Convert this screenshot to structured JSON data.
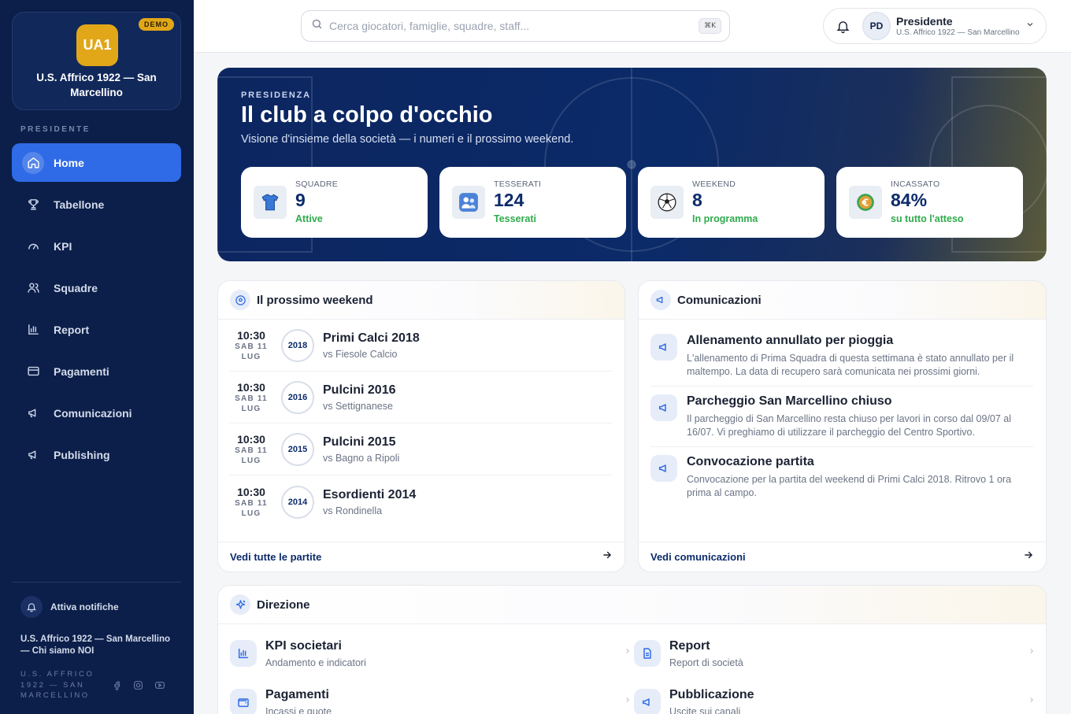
{
  "sidebar": {
    "demo_badge": "DEMO",
    "club_logo": "UA1",
    "club_name": "U.S. Affrico 1922 — San Marcellino",
    "role_label": "PRESIDENTE",
    "items": [
      {
        "label": "Home",
        "icon": "home-icon"
      },
      {
        "label": "Tabellone",
        "icon": "trophy-icon"
      },
      {
        "label": "KPI",
        "icon": "gauge-icon"
      },
      {
        "label": "Squadre",
        "icon": "users-icon"
      },
      {
        "label": "Report",
        "icon": "bar-chart-icon"
      },
      {
        "label": "Pagamenti",
        "icon": "credit-card-icon"
      },
      {
        "label": "Comunicazioni",
        "icon": "megaphone-icon"
      },
      {
        "label": "Publishing",
        "icon": "megaphone-icon"
      }
    ],
    "notifications_label": "Attiva notifiche",
    "footer_club": "U.S. Affrico 1922 — San Marcellino — Chi siamo NOI",
    "footer_small": "U.S. AFFRICO 1922 — SAN MARCELLINO"
  },
  "topbar": {
    "search_placeholder": "Cerca giocatori, famiglie, squadre, staff...",
    "search_shortcut": "⌘K",
    "avatar_initials": "PD",
    "user_name": "Presidente",
    "user_sub": "U.S. Affrico 1922 — San Marcellino"
  },
  "hero": {
    "kicker": "PRESIDENZA",
    "title": "Il club a colpo d'occhio",
    "subtitle": "Visione d'insieme della società — i numeri e il prossimo weekend.",
    "stats": [
      {
        "label": "SQUADRE",
        "value": "9",
        "note": "Attive",
        "icon": "jersey-icon"
      },
      {
        "label": "TESSERATI",
        "value": "124",
        "note": "Tesserati",
        "icon": "people-icon"
      },
      {
        "label": "WEEKEND",
        "value": "8",
        "note": "In programma",
        "icon": "soccer-ball-icon"
      },
      {
        "label": "INCASSATO",
        "value": "84%",
        "note": "su tutto l'atteso",
        "icon": "euro-coin-icon"
      }
    ]
  },
  "weekend": {
    "title": "Il prossimo weekend",
    "matches": [
      {
        "time": "10:30",
        "day": "SAB 11",
        "month": "LUG",
        "year": "2018",
        "team": "Primi Calci 2018",
        "opponent": "vs Fiesole Calcio"
      },
      {
        "time": "10:30",
        "day": "SAB 11",
        "month": "LUG",
        "year": "2016",
        "team": "Pulcini 2016",
        "opponent": "vs Settignanese"
      },
      {
        "time": "10:30",
        "day": "SAB 11",
        "month": "LUG",
        "year": "2015",
        "team": "Pulcini 2015",
        "opponent": "vs Bagno a Ripoli"
      },
      {
        "time": "10:30",
        "day": "SAB 11",
        "month": "LUG",
        "year": "2014",
        "team": "Esordienti 2014",
        "opponent": "vs Rondinella"
      }
    ],
    "footer_link": "Vedi tutte le partite"
  },
  "comunicazioni": {
    "title": "Comunicazioni",
    "items": [
      {
        "title": "Allenamento annullato per pioggia",
        "body": "L'allenamento di Prima Squadra di questa settimana è stato annullato per il maltempo. La data di recupero sarà comunicata nei prossimi giorni."
      },
      {
        "title": "Parcheggio San Marcellino chiuso",
        "body": "Il parcheggio di San Marcellino resta chiuso per lavori in corso dal 09/07 al 16/07. Vi preghiamo di utilizzare il parcheggio del Centro Sportivo."
      },
      {
        "title": "Convocazione partita",
        "body": "Convocazione per la partita del weekend di Primi Calci 2018. Ritrovo 1 ora prima al campo."
      }
    ],
    "footer_link": "Vedi comunicazioni"
  },
  "direzione": {
    "title": "Direzione",
    "items": [
      {
        "title": "KPI societari",
        "sub": "Andamento e indicatori",
        "icon": "bar-chart-icon"
      },
      {
        "title": "Report",
        "sub": "Report di società",
        "icon": "document-icon"
      },
      {
        "title": "Pagamenti",
        "sub": "Incassi e quote",
        "icon": "wallet-icon"
      },
      {
        "title": "Pubblicazione",
        "sub": "Uscite sui canali",
        "icon": "megaphone-icon"
      }
    ]
  },
  "colors": {
    "sidebar_bg": "#0c1f4a",
    "accent": "#2f6be6",
    "gold": "#e1a719",
    "positive": "#2eab4c"
  }
}
